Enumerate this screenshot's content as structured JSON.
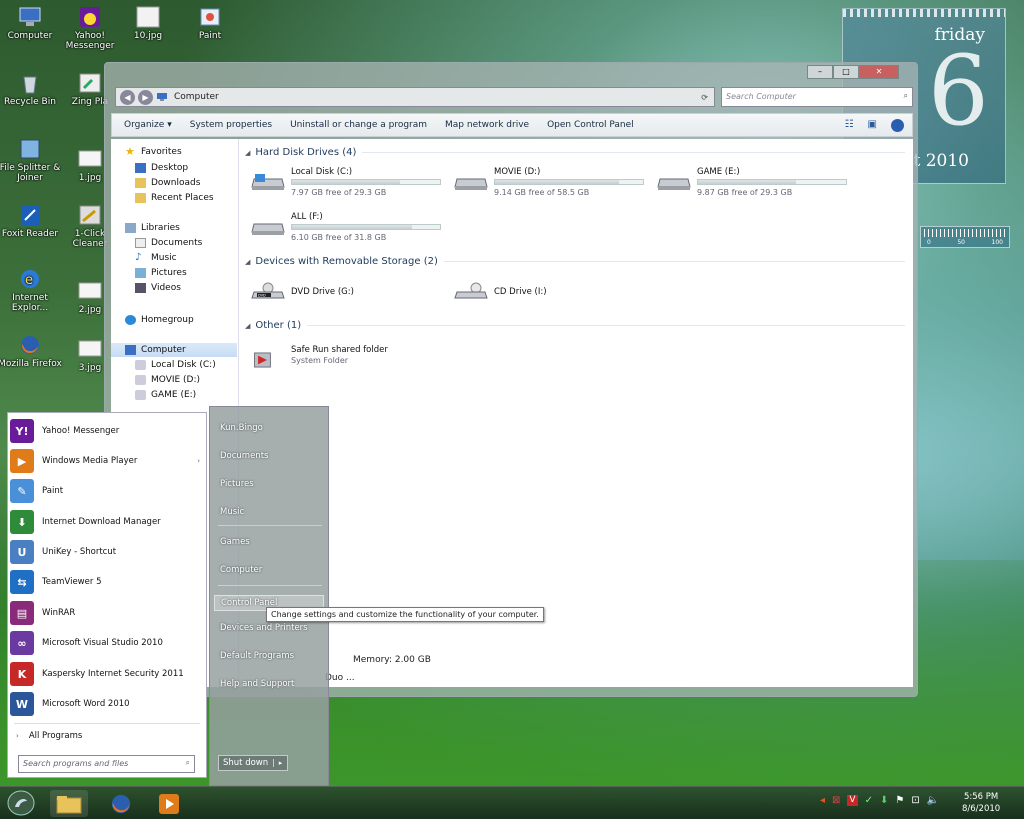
{
  "desktop": {
    "icons": [
      {
        "label": "Computer"
      },
      {
        "label": "Yahoo! Messenger"
      },
      {
        "label": "10.jpg"
      },
      {
        "label": "Paint"
      },
      {
        "label": "Recycle Bin"
      },
      {
        "label": "Zing Pla"
      },
      {
        "label": "File Splitter & Joiner"
      },
      {
        "label": "1.jpg"
      },
      {
        "label": "Foxit Reader"
      },
      {
        "label": "1-Click Cleaner"
      },
      {
        "label": "Internet Explor..."
      },
      {
        "label": "2.jpg"
      },
      {
        "label": "Mozilla Firefox"
      },
      {
        "label": "3.jpg"
      }
    ]
  },
  "gadget": {
    "day": "friday",
    "date": "6",
    "month": "st 2010",
    "meter_labels": [
      "0",
      "50",
      "100"
    ]
  },
  "explorer": {
    "window_buttons": {
      "min": "–",
      "max": "□",
      "close": "✕"
    },
    "address": {
      "location": "Computer"
    },
    "search_placeholder": "Search Computer",
    "toolbar": [
      "Organize",
      "System properties",
      "Uninstall or change a program",
      "Map network drive",
      "Open Control Panel"
    ],
    "organize_arrow": "▾",
    "nav": {
      "favorites": "Favorites",
      "favorites_items": [
        "Desktop",
        "Downloads",
        "Recent Places"
      ],
      "libraries": "Libraries",
      "libraries_items": [
        "Documents",
        "Music",
        "Pictures",
        "Videos"
      ],
      "homegroup": "Homegroup",
      "computer": "Computer",
      "computer_items": [
        "Local Disk (C:)",
        "MOVIE (D:)",
        "GAME (E:)"
      ]
    },
    "groups": {
      "hard_disks": "Hard Disk Drives (4)",
      "removable": "Devices with Removable Storage (2)",
      "other": "Other (1)"
    },
    "drives": [
      {
        "name": "Local Disk (C:)",
        "free": "7.97 GB free of 29.3 GB",
        "used_fraction": 0.73
      },
      {
        "name": "MOVIE (D:)",
        "free": "9.14 GB free of 58.5 GB",
        "used_fraction": 0.84
      },
      {
        "name": "GAME (E:)",
        "free": "9.87 GB free of 29.3 GB",
        "used_fraction": 0.66
      },
      {
        "name": "ALL (F:)",
        "free": "6.10 GB free of 31.8 GB",
        "used_fraction": 0.81
      }
    ],
    "removable": [
      {
        "name": "DVD Drive (G:)",
        "badge": "DVD"
      },
      {
        "name": "CD Drive (I:)"
      }
    ],
    "other": {
      "name": "Safe Run shared folder",
      "type": "System Folder"
    },
    "status": {
      "memory": "Memory: 2.00 GB",
      "cpu": "Duo ..."
    }
  },
  "start_menu": {
    "programs": [
      {
        "label": "Yahoo! Messenger",
        "color": "#6a1b9a",
        "glyph": "Y!"
      },
      {
        "label": "Windows Media Player",
        "color": "#e07b1a",
        "glyph": "▶",
        "has_sub": true
      },
      {
        "label": "Paint",
        "color": "#4a90d9",
        "glyph": "✎"
      },
      {
        "label": "Internet Download Manager",
        "color": "#2e8b3a",
        "glyph": "⬇"
      },
      {
        "label": "UniKey - Shortcut",
        "color": "#4a7fc1",
        "glyph": "U"
      },
      {
        "label": "TeamViewer 5",
        "color": "#1f6fc4",
        "glyph": "⇆"
      },
      {
        "label": "WinRAR",
        "color": "#8a2a7a",
        "glyph": "▤"
      },
      {
        "label": "Microsoft Visual Studio 2010",
        "color": "#6a3aa0",
        "glyph": "∞"
      },
      {
        "label": "Kaspersky Internet Security 2011",
        "color": "#c62828",
        "glyph": "K"
      },
      {
        "label": "Microsoft Word 2010",
        "color": "#2b579a",
        "glyph": "W"
      }
    ],
    "sub_arrow": "›",
    "all_programs_arrow": "›",
    "all_programs": "All Programs",
    "search_placeholder": "Search programs and files",
    "right_items": [
      "Kun.Bingo",
      "Documents",
      "Pictures",
      "Music",
      "Games",
      "Computer",
      "Control Panel",
      "Devices and Printers",
      "Default Programs",
      "Help and Support"
    ],
    "shutdown": "Shut down",
    "shutdown_arrow": "▸",
    "tooltip": "Change settings and customize the functionality of your computer."
  },
  "taskbar": {
    "time": "5:56 PM",
    "date": "8/6/2010"
  }
}
